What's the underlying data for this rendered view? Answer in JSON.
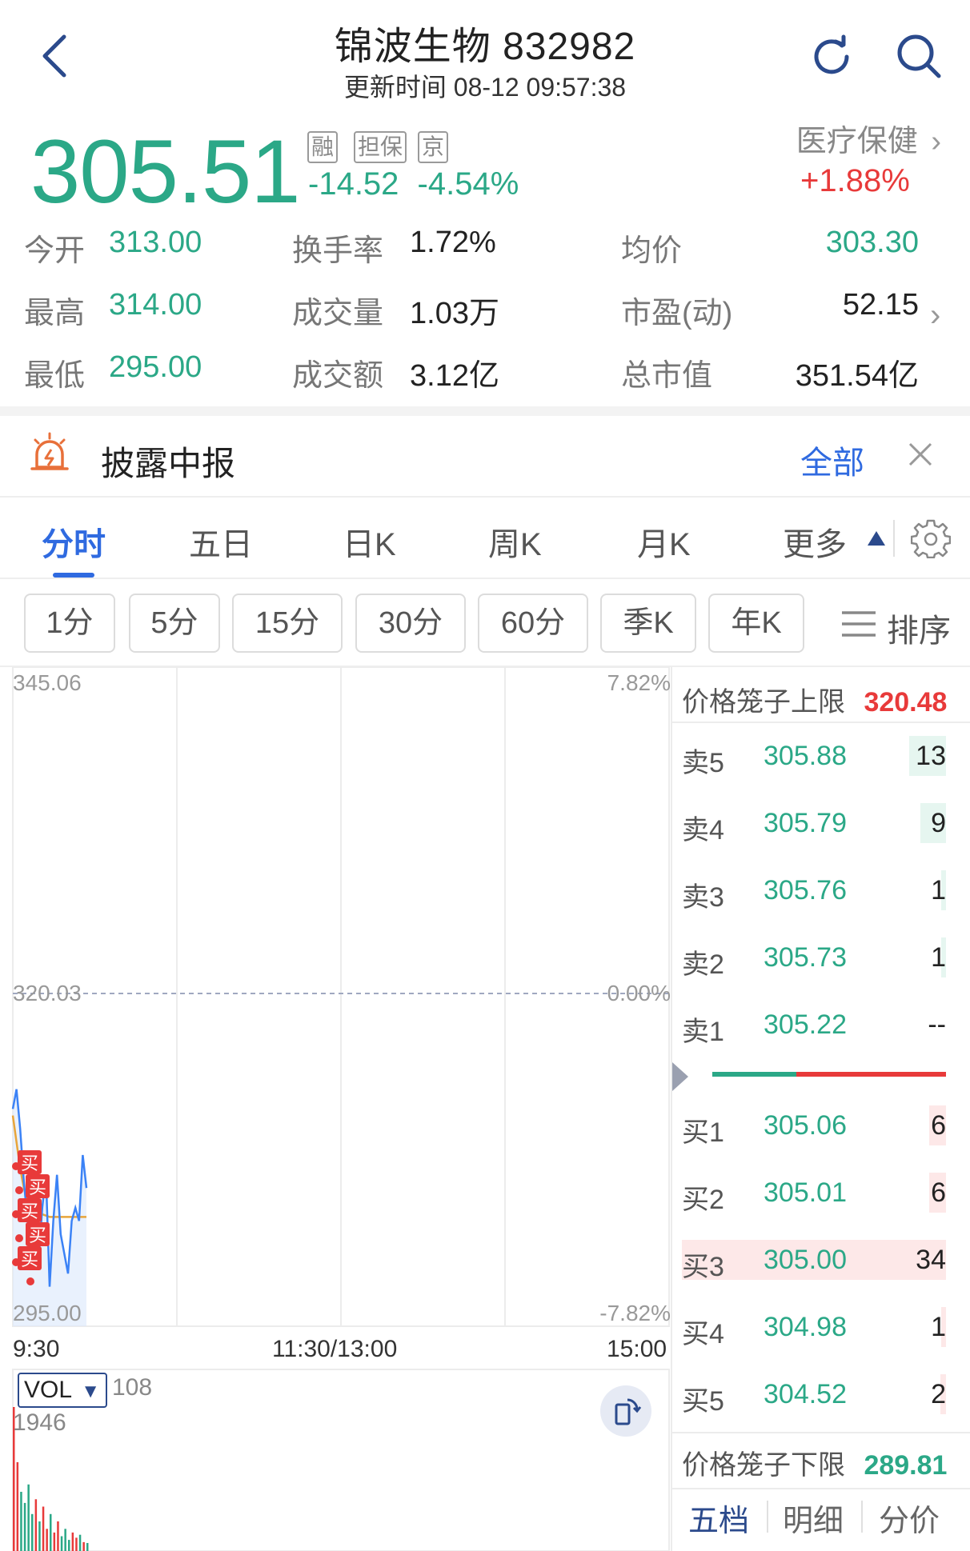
{
  "header": {
    "title": "锦波生物 832982",
    "update_time": "更新时间 08-12 09:57:38"
  },
  "quote": {
    "price": "305.51",
    "tags": [
      "融",
      "担保",
      "京"
    ],
    "change": "-14.52",
    "change_pct": "-4.54%",
    "sector_name": "医疗保健",
    "sector_pct": "+1.88%"
  },
  "stats": {
    "open_label": "今开",
    "open_value": "313.00",
    "high_label": "最高",
    "high_value": "314.00",
    "low_label": "最低",
    "low_value": "295.00",
    "turnover_label": "换手率",
    "turnover_value": "1.72%",
    "volume_label": "成交量",
    "volume_value": "1.03万",
    "amount_label": "成交额",
    "amount_value": "3.12亿",
    "avg_label": "均价",
    "avg_value": "303.30",
    "pe_label": "市盈(动)",
    "pe_value": "52.15",
    "mcap_label": "总市值",
    "mcap_value": "351.54亿"
  },
  "disclosure": {
    "title": "披露中报",
    "all_label": "全部"
  },
  "tabs": [
    "分时",
    "五日",
    "日K",
    "周K",
    "月K",
    "更多"
  ],
  "periods": [
    "1分",
    "5分",
    "15分",
    "30分",
    "60分",
    "季K",
    "年K"
  ],
  "sort_label": "排序",
  "chart": {
    "y_top": "345.06",
    "y_mid": "320.03",
    "y_bottom": "295.00",
    "pct_top": "7.82%",
    "pct_mid": "0.00%",
    "pct_bottom": "-7.82%",
    "x_start": "9:30",
    "x_mid": "11:30/13:00",
    "x_end": "15:00",
    "buy_marker": "买",
    "vol_label": "VOL",
    "vol_value": "108",
    "vol_max": "1946",
    "colors": {
      "price": "#3b82f6",
      "avg": "#e8a53a",
      "up": "#e83a3a",
      "down": "#2ba887"
    }
  },
  "chart_data": {
    "type": "line",
    "x_range": [
      "9:30",
      "15:00"
    ],
    "ylim": [
      295.0,
      345.06
    ],
    "series": [],
    "price_line": [
      311.5,
      313.0,
      310.0,
      306.0,
      303.0,
      301.5,
      305.0,
      300.0,
      304.0,
      306.5,
      298.0,
      303.0,
      306.5,
      302.0,
      300.5,
      299.0,
      303.0,
      304.0,
      303.0,
      308.0,
      305.5
    ],
    "avg_line": [
      311.0,
      309.0,
      307.0,
      305.5,
      304.5,
      304.0,
      303.8,
      303.6,
      303.5,
      303.4,
      303.3,
      303.3,
      303.3,
      303.3,
      303.3,
      303.3,
      303.3,
      303.3,
      303.3,
      303.3,
      303.3
    ],
    "volume": [
      1946,
      1200,
      800,
      650,
      900,
      500,
      700,
      400,
      600,
      300,
      500,
      250,
      400,
      200,
      300,
      150,
      250,
      180,
      220,
      120,
      108
    ]
  },
  "orderbook": {
    "upper_label": "价格笼子上限",
    "upper_value": "320.48",
    "lower_label": "价格笼子下限",
    "lower_value": "289.81",
    "asks": [
      {
        "label": "卖5",
        "price": "305.88",
        "vol": "13",
        "bar": 13
      },
      {
        "label": "卖4",
        "price": "305.79",
        "vol": "9",
        "bar": 9
      },
      {
        "label": "卖3",
        "price": "305.76",
        "vol": "1",
        "bar": 1
      },
      {
        "label": "卖2",
        "price": "305.73",
        "vol": "1",
        "bar": 1
      },
      {
        "label": "卖1",
        "price": "305.22",
        "vol": "--",
        "bar": 0
      }
    ],
    "bids": [
      {
        "label": "买1",
        "price": "305.06",
        "vol": "6",
        "bar": 6
      },
      {
        "label": "买2",
        "price": "305.01",
        "vol": "6",
        "bar": 6
      },
      {
        "label": "买3",
        "price": "305.00",
        "vol": "34",
        "bar": 34
      },
      {
        "label": "买4",
        "price": "304.98",
        "vol": "1",
        "bar": 1
      },
      {
        "label": "买5",
        "price": "304.52",
        "vol": "2",
        "bar": 2
      }
    ],
    "buy_sell_ratio": 0.36
  },
  "bottom_tabs": [
    "五档",
    "明细",
    "分价"
  ]
}
